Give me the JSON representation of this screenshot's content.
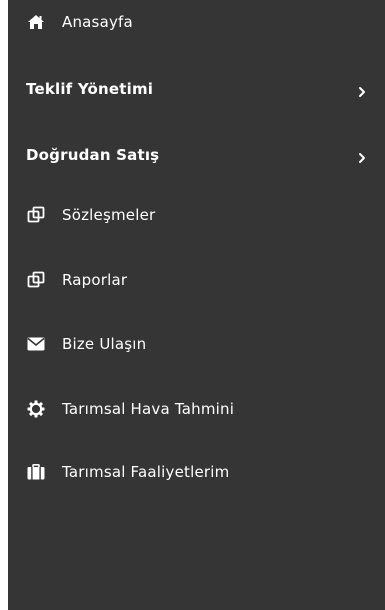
{
  "sidebar": {
    "items": [
      {
        "label": "Anasayfa",
        "icon": "home-icon"
      },
      {
        "label": "Teklif Yönetimi",
        "icon": "",
        "has_submenu": true
      },
      {
        "label": "Doğrudan Satış",
        "icon": "",
        "has_submenu": true
      },
      {
        "label": "Sözleşmeler",
        "icon": "clone-icon"
      },
      {
        "label": "Raporlar",
        "icon": "clone-icon"
      },
      {
        "label": "Bize Ulaşın",
        "icon": "envelope-icon"
      },
      {
        "label": "Tarımsal Hava Tahmini",
        "icon": "gear-icon"
      },
      {
        "label": "Tarımsal Faaliyetlerim",
        "icon": "briefcase-icon"
      }
    ]
  },
  "colors": {
    "sidebar_bg": "#353535",
    "text": "#ffffff"
  }
}
